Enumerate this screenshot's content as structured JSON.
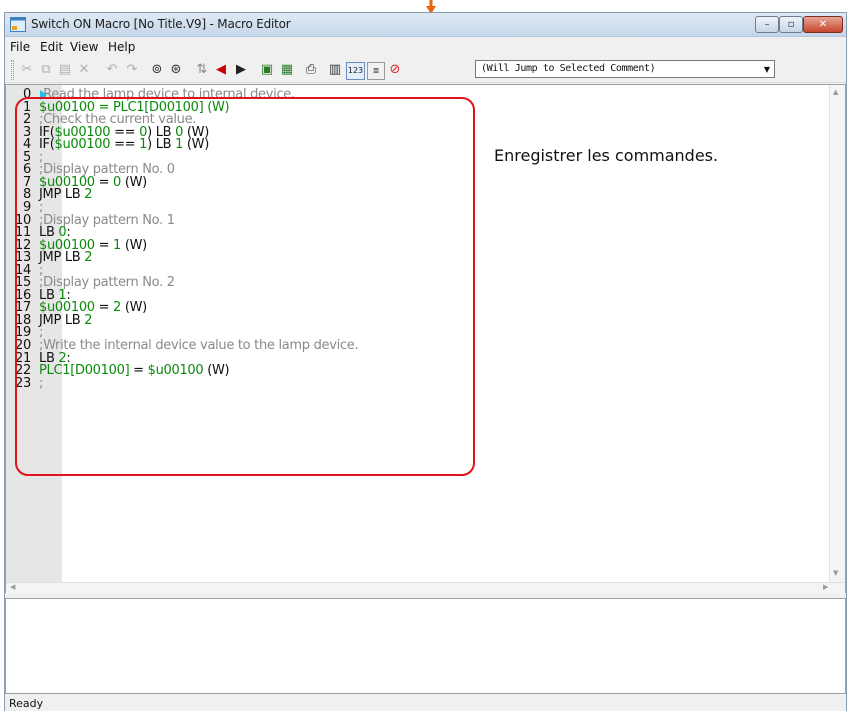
{
  "window": {
    "title": "Switch ON Macro [No Title.V9] - Macro Editor",
    "controls": {
      "minimize": "–",
      "maximize": "▫",
      "close": "✕"
    }
  },
  "menu": [
    "File",
    "Edit",
    "View",
    "Help"
  ],
  "toolbar": {
    "icons": {
      "cut": "scissors-icon",
      "copy": "copy-icon",
      "paste": "paste-icon",
      "delete": "delete-icon",
      "undo": "undo-icon",
      "redo": "redo-icon",
      "find": "binoculars-icon",
      "replace": "find-replace-icon",
      "jump": "jump-icon",
      "back": "back-arrow-icon",
      "forward": "forward-arrow-icon",
      "import": "import-icon",
      "export": "export-icon",
      "print": "printer-icon",
      "table": "table-icon",
      "number": "number-icon",
      "comment": "comment-icon",
      "stop": "stop-icon"
    },
    "number_label": "123",
    "comment_select": {
      "value": "(Will Jump to Selected Comment)"
    }
  },
  "editor": {
    "lines": [
      {
        "num": "0",
        "parts": [
          {
            "t": ";Read the lamp device to internal device.",
            "c": "comment"
          }
        ]
      },
      {
        "num": "1",
        "parts": [
          {
            "t": "$u00100 = PLC1[D00100] (W)",
            "c": "green"
          }
        ]
      },
      {
        "num": "2",
        "parts": [
          {
            "t": ";Check the current value.",
            "c": "comment"
          }
        ]
      },
      {
        "num": "3",
        "parts": [
          {
            "t": "IF(",
            "c": "black"
          },
          {
            "t": "$u00100",
            "c": "green"
          },
          {
            "t": " == ",
            "c": "black"
          },
          {
            "t": "0",
            "c": "green"
          },
          {
            "t": ") LB ",
            "c": "black"
          },
          {
            "t": "0",
            "c": "green"
          },
          {
            "t": " (W)",
            "c": "black"
          }
        ]
      },
      {
        "num": "4",
        "parts": [
          {
            "t": "IF(",
            "c": "black"
          },
          {
            "t": "$u00100",
            "c": "green"
          },
          {
            "t": " == ",
            "c": "black"
          },
          {
            "t": "1",
            "c": "green"
          },
          {
            "t": ") LB ",
            "c": "black"
          },
          {
            "t": "1",
            "c": "green"
          },
          {
            "t": " (W)",
            "c": "black"
          }
        ]
      },
      {
        "num": "5",
        "parts": [
          {
            "t": ";",
            "c": "comment"
          }
        ]
      },
      {
        "num": "6",
        "parts": [
          {
            "t": ";Display pattern No. 0",
            "c": "comment"
          }
        ]
      },
      {
        "num": "7",
        "parts": [
          {
            "t": "$u00100",
            "c": "green"
          },
          {
            "t": " = ",
            "c": "black"
          },
          {
            "t": "0",
            "c": "green"
          },
          {
            "t": " (W)",
            "c": "black"
          }
        ]
      },
      {
        "num": "8",
        "parts": [
          {
            "t": "JMP LB ",
            "c": "black"
          },
          {
            "t": "2",
            "c": "green"
          }
        ]
      },
      {
        "num": "9",
        "parts": [
          {
            "t": ";",
            "c": "comment"
          }
        ]
      },
      {
        "num": "10",
        "parts": [
          {
            "t": ";Display pattern No. 1",
            "c": "comment"
          }
        ]
      },
      {
        "num": "11",
        "parts": [
          {
            "t": "LB ",
            "c": "black"
          },
          {
            "t": "0",
            "c": "green"
          },
          {
            "t": ":",
            "c": "black"
          }
        ]
      },
      {
        "num": "12",
        "parts": [
          {
            "t": "$u00100",
            "c": "green"
          },
          {
            "t": " = ",
            "c": "black"
          },
          {
            "t": "1",
            "c": "green"
          },
          {
            "t": " (W)",
            "c": "black"
          }
        ]
      },
      {
        "num": "13",
        "parts": [
          {
            "t": "JMP LB ",
            "c": "black"
          },
          {
            "t": "2",
            "c": "green"
          }
        ]
      },
      {
        "num": "14",
        "parts": [
          {
            "t": ";",
            "c": "comment"
          }
        ]
      },
      {
        "num": "15",
        "parts": [
          {
            "t": ";Display pattern No. 2",
            "c": "comment"
          }
        ]
      },
      {
        "num": "16",
        "parts": [
          {
            "t": "LB ",
            "c": "black"
          },
          {
            "t": "1",
            "c": "green"
          },
          {
            "t": ":",
            "c": "black"
          }
        ]
      },
      {
        "num": "17",
        "parts": [
          {
            "t": "$u00100",
            "c": "green"
          },
          {
            "t": " = ",
            "c": "black"
          },
          {
            "t": "2",
            "c": "green"
          },
          {
            "t": " (W)",
            "c": "black"
          }
        ]
      },
      {
        "num": "18",
        "parts": [
          {
            "t": "JMP LB ",
            "c": "black"
          },
          {
            "t": "2",
            "c": "green"
          }
        ]
      },
      {
        "num": "19",
        "parts": [
          {
            "t": ";",
            "c": "comment"
          }
        ]
      },
      {
        "num": "20",
        "parts": [
          {
            "t": ";Write the internal device value to the lamp device.",
            "c": "comment"
          }
        ]
      },
      {
        "num": "21",
        "parts": [
          {
            "t": "LB ",
            "c": "black"
          },
          {
            "t": "2",
            "c": "green"
          },
          {
            "t": ":",
            "c": "black"
          }
        ]
      },
      {
        "num": "22",
        "parts": [
          {
            "t": "PLC1[D00100]",
            "c": "green"
          },
          {
            "t": " = ",
            "c": "black"
          },
          {
            "t": "$u00100",
            "c": "green"
          },
          {
            "t": " (W)",
            "c": "black"
          }
        ]
      },
      {
        "num": "23",
        "parts": [
          {
            "t": ";",
            "c": "comment"
          }
        ]
      }
    ],
    "annotation": "Enregistrer les commandes.",
    "callout_color": "#e0121a"
  },
  "status": {
    "text": "Ready"
  },
  "colors": {
    "comment": "#8a8a8a",
    "keyword_value": "#0a8a0a",
    "code": "#111111",
    "accent_arrow": "#e8650c"
  }
}
